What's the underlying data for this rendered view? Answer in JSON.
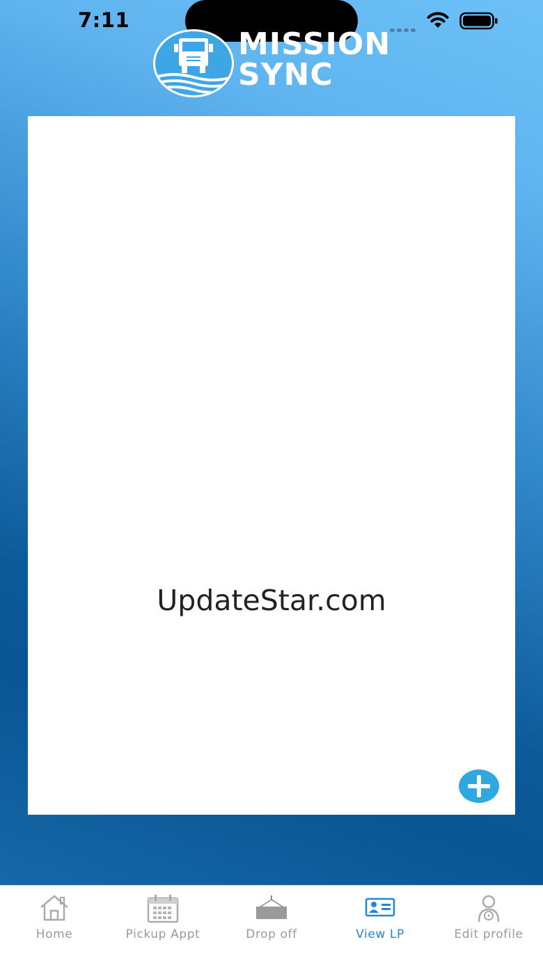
{
  "status_bar": {
    "time": "7:11"
  },
  "header": {
    "logo_line1": "MISSION",
    "logo_line2": "SYNC"
  },
  "content": {
    "placeholder_text": "UpdateStar.com"
  },
  "tabbar": {
    "tabs": [
      {
        "label": "Home",
        "icon": "home-icon",
        "active": false
      },
      {
        "label": "Pickup Appt",
        "icon": "calendar-icon",
        "active": false
      },
      {
        "label": "Drop off",
        "icon": "container-drop-icon",
        "active": false
      },
      {
        "label": "View LP",
        "icon": "license-card-icon",
        "active": true
      },
      {
        "label": "Edit profile",
        "icon": "profile-icon",
        "active": false
      }
    ]
  },
  "colors": {
    "accent": "#1e88d8",
    "fab": "#2fa8e1",
    "tab_inactive": "#9a9a9a",
    "gradient_top": "#6cc1f7",
    "gradient_bottom": "#0a5593"
  }
}
